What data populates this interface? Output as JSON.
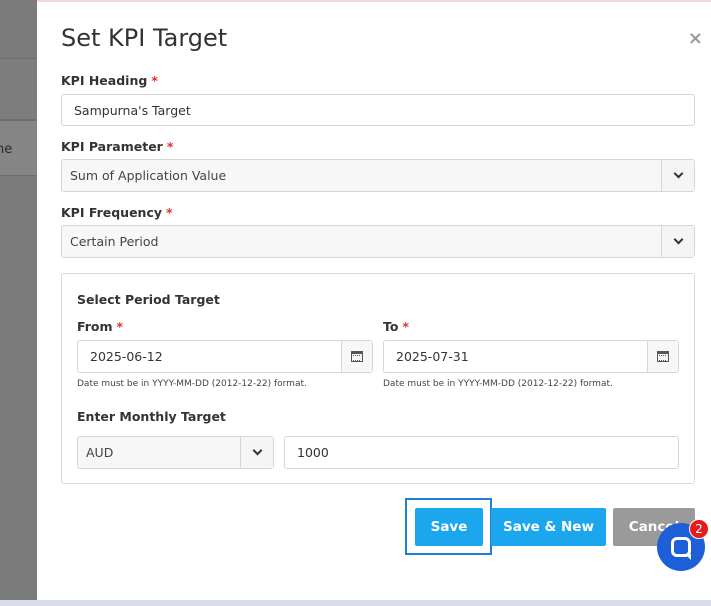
{
  "background": {
    "row_text": "ne"
  },
  "modal": {
    "title": "Set KPI Target",
    "close_symbol": "×"
  },
  "kpi_heading": {
    "label": "KPI Heading",
    "required": "*",
    "value": "Sampurna's Target"
  },
  "kpi_parameter": {
    "label": "KPI Parameter",
    "required": "*",
    "selected": "Sum of Application Value"
  },
  "kpi_frequency": {
    "label": "KPI Frequency",
    "required": "*",
    "selected": "Certain Period"
  },
  "period": {
    "title": "Select Period Target",
    "from": {
      "label": "From",
      "required": "*",
      "value": "2025-06-12",
      "hint": "Date must be in YYYY-MM-DD (2012-12-22) format."
    },
    "to": {
      "label": "To",
      "required": "*",
      "value": "2025-07-31",
      "hint": "Date must be in YYYY-MM-DD (2012-12-22) format."
    },
    "monthly_target_label": "Enter Monthly Target",
    "currency": "AUD",
    "amount": "1000"
  },
  "buttons": {
    "save": "Save",
    "save_new": "Save & New",
    "cancel": "Cancel"
  },
  "chat": {
    "badge_count": "2"
  },
  "icons": {
    "close": "close-icon",
    "chevron": "chevron-down-icon",
    "calendar": "calendar-icon",
    "chat": "chat-icon"
  },
  "colors": {
    "primary": "#1ca6ee",
    "cancel": "#9a9a9a",
    "required": "#e03030",
    "chat": "#1d5fd6",
    "badge": "#e41c1c"
  }
}
